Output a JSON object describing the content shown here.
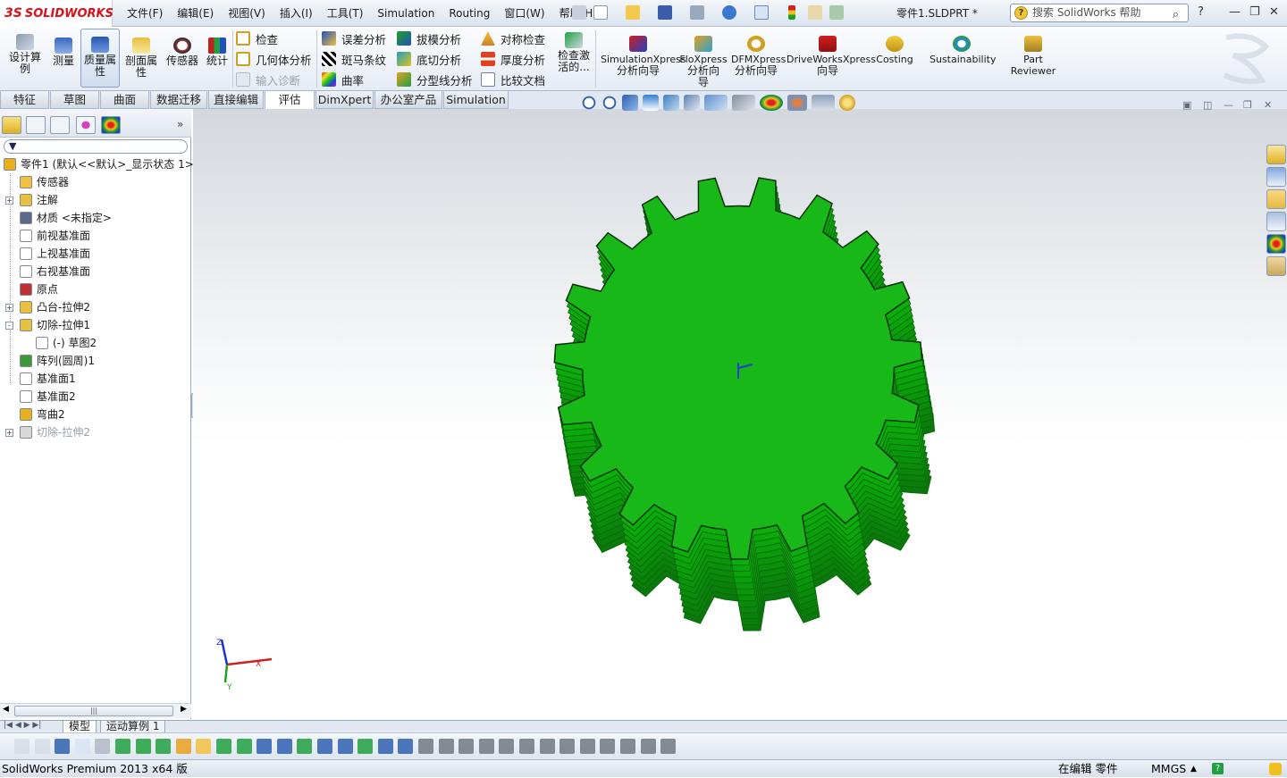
{
  "app": {
    "brand": "SOLIDWORKS",
    "brand_prefix": "3S",
    "document_title": "零件1.SLDPRT *"
  },
  "menu": [
    "文件(F)",
    "编辑(E)",
    "视图(V)",
    "插入(I)",
    "工具(T)",
    "Simulation",
    "Routing",
    "窗口(W)",
    "帮助(H)"
  ],
  "help_search": {
    "placeholder": "搜索 SolidWorks 帮助"
  },
  "ribbon": {
    "large_buttons": [
      {
        "name": "design-study-button",
        "label": "设计算例",
        "icon": "design-study-icon"
      },
      {
        "name": "measure-button",
        "label": "测量",
        "icon": "measure-icon"
      },
      {
        "name": "mass-properties-button",
        "label": "质量属性",
        "icon": "balance-scale-icon"
      },
      {
        "name": "section-properties-button",
        "label": "剖面属性",
        "icon": "section-icon"
      },
      {
        "name": "sensor-button",
        "label": "传感器",
        "icon": "gauge-icon"
      },
      {
        "name": "statistics-button",
        "label": "统计",
        "icon": "stats-icon"
      }
    ],
    "small_col1": [
      "检查",
      "几何体分析",
      "输入诊断"
    ],
    "small_col2": [
      "误差分析",
      "斑马条纹",
      "曲率"
    ],
    "small_col3": [
      "拔模分析",
      "底切分析",
      "分型线分析"
    ],
    "small_col4": [
      "对称检查",
      "厚度分析",
      "比较文档"
    ],
    "check_active": "检查激活的...",
    "xpress": [
      {
        "name": "simulationxpress-button",
        "l1": "SimulationXpress",
        "l2": "分析向导"
      },
      {
        "name": "floxpress-button",
        "l1": "FloXpress",
        "l2": "分析向",
        "l3": "导"
      },
      {
        "name": "dfmxpress-button",
        "l1": "DFMXpress",
        "l2": "分析向导"
      },
      {
        "name": "driveworksxpress-button",
        "l1": "DriveWorksXpress",
        "l2": "向导"
      },
      {
        "name": "costing-button",
        "l1": "Costing"
      },
      {
        "name": "sustainability-button",
        "l1": "Sustainability"
      },
      {
        "name": "part-reviewer-button",
        "l1": "Part",
        "l2": "Reviewer"
      }
    ]
  },
  "tabs": [
    "特征",
    "草图",
    "曲面",
    "数据迁移",
    "直接编辑",
    "评估",
    "DimXpert",
    "办公室产品",
    "Simulation"
  ],
  "active_tab": "评估",
  "tree": [
    {
      "label": "零件1  (默认<<默认>_显示状态 1>",
      "indent": 0,
      "exp": "",
      "color": "#e8b020"
    },
    {
      "label": "传感器",
      "indent": 1,
      "exp": "",
      "color": "#f0c040"
    },
    {
      "label": "注解",
      "indent": 1,
      "exp": "+",
      "color": "#e8c040"
    },
    {
      "label": "材质 <未指定>",
      "indent": 1,
      "exp": "",
      "color": "#5a6a8a"
    },
    {
      "label": "前视基准面",
      "indent": 1,
      "exp": "",
      "color": "#ffffff"
    },
    {
      "label": "上视基准面",
      "indent": 1,
      "exp": "",
      "color": "#ffffff"
    },
    {
      "label": "右视基准面",
      "indent": 1,
      "exp": "",
      "color": "#ffffff"
    },
    {
      "label": "原点",
      "indent": 1,
      "exp": "",
      "color": "#c03030"
    },
    {
      "label": "凸台-拉伸2",
      "indent": 1,
      "exp": "+",
      "color": "#e8c040"
    },
    {
      "label": "切除-拉伸1",
      "indent": 1,
      "exp": "-",
      "color": "#e8c040"
    },
    {
      "label": "(-) 草图2",
      "indent": 2,
      "exp": "",
      "color": "#ffffff"
    },
    {
      "label": "阵列(圆周)1",
      "indent": 1,
      "exp": "",
      "color": "#3a9a3a"
    },
    {
      "label": "基准面1",
      "indent": 1,
      "exp": "",
      "color": "#ffffff"
    },
    {
      "label": "基准面2",
      "indent": 1,
      "exp": "",
      "color": "#ffffff"
    },
    {
      "label": "弯曲2",
      "indent": 1,
      "exp": "",
      "color": "#e8b020"
    },
    {
      "label": "切除-拉伸2",
      "indent": 1,
      "exp": "+",
      "color": "#d8d8d8",
      "dim": true
    }
  ],
  "bottom_tabs": [
    "模型",
    "运动算例 1"
  ],
  "status": {
    "left": "SolidWorks Premium 2013 x64 版",
    "mode": "在编辑 零件",
    "units": "MMGS"
  },
  "triad": {
    "x": "X",
    "y": "Y",
    "z": "Z"
  },
  "colors": {
    "gear": "#18b818",
    "gear_dark": "#0a6a0a",
    "accent": "#d7121c"
  }
}
